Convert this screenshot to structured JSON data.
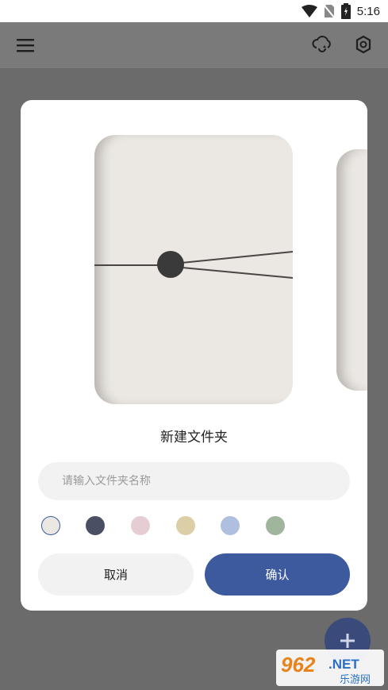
{
  "status_bar": {
    "time": "5:16",
    "icons": [
      "wifi-icon",
      "no-sim-icon",
      "battery-icon"
    ]
  },
  "app_bar": {
    "icons": [
      "menu-icon",
      "cloud-sync-icon",
      "settings-icon"
    ]
  },
  "dialog": {
    "title": "新建文件夹",
    "name_input": {
      "placeholder": "请输入文件夹名称",
      "value": ""
    },
    "colors": [
      "#ebe8e3",
      "#4a4f63",
      "#e6cdd3",
      "#dccfa8",
      "#aebfe0",
      "#9fb59c"
    ],
    "selected_color_index": 0,
    "cancel_label": "取消",
    "confirm_label": "确认"
  },
  "accent_color": "#3d5a9e",
  "fab": {
    "icon": "plus-icon"
  },
  "watermark": {
    "brand": "962.NET",
    "subtitle": "乐游网"
  }
}
